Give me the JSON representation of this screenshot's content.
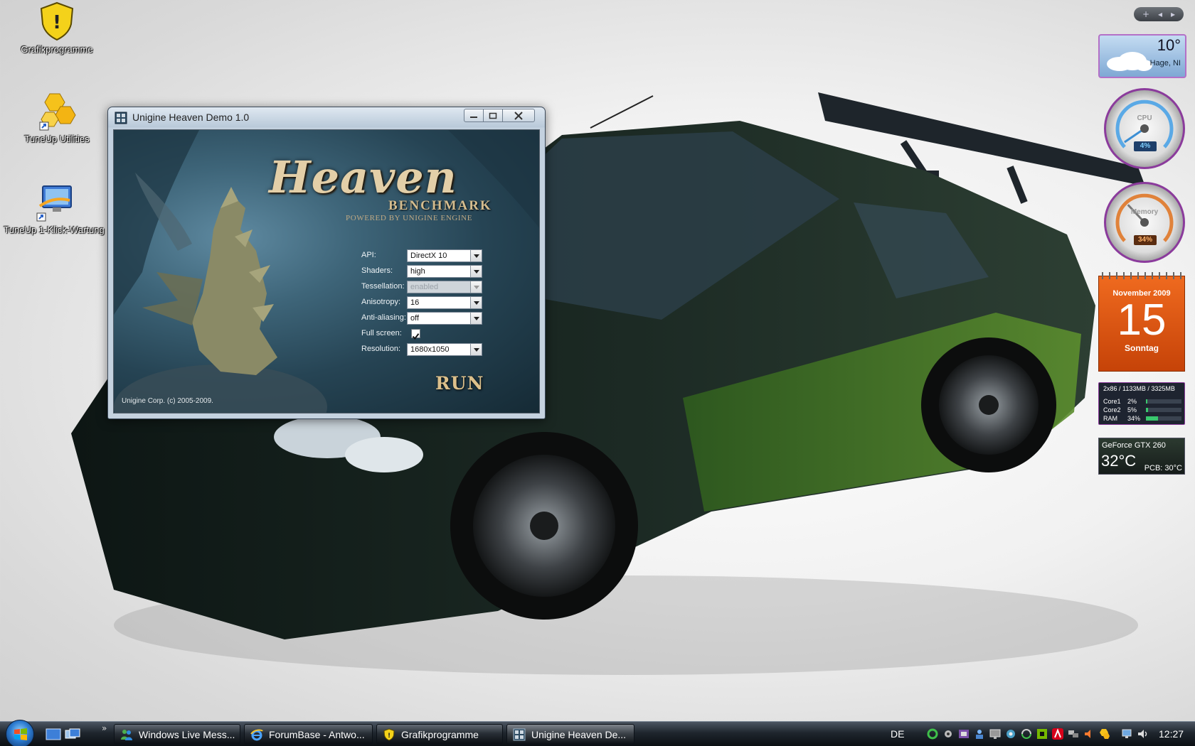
{
  "desktop": {
    "icons": [
      {
        "label": "Grafikprogramme",
        "icon": "shield-warning-icon"
      },
      {
        "label": "TuneUp Utilities",
        "icon": "tuneup-icon"
      },
      {
        "label": "TuneUp 1-Klick-Wartung",
        "icon": "monitor-shortcut-icon"
      }
    ]
  },
  "window": {
    "title": "Unigine Heaven Demo 1.0",
    "brand": {
      "title": "Heaven",
      "subtitle": "BENCHMARK",
      "powered": "POWERED BY UNIGINE ENGINE"
    },
    "options": {
      "api": {
        "label": "API:",
        "value": "DirectX 10"
      },
      "shaders": {
        "label": "Shaders:",
        "value": "high"
      },
      "tessellation": {
        "label": "Tessellation:",
        "value": "enabled",
        "disabled": true
      },
      "anisotropy": {
        "label": "Anisotropy:",
        "value": "16"
      },
      "antialiasing": {
        "label": "Anti-aliasing:",
        "value": "off"
      },
      "fullscreen": {
        "label": "Full screen:",
        "checked": true
      },
      "resolution": {
        "label": "Resolution:",
        "value": "1680x1050"
      }
    },
    "run_label": "RUN",
    "copyright": "Unigine Corp. (c) 2005-2009."
  },
  "sidebar": {
    "controls": [
      "+",
      "◂",
      "▸"
    ],
    "weather": {
      "temp": "10°",
      "location": "Hage, NI"
    },
    "cpu_gauge": {
      "label": "CPU",
      "value": "4%",
      "fraction": 0.04
    },
    "memory_gauge": {
      "label": "Memory",
      "value": "34%",
      "fraction": 0.34
    },
    "calendar": {
      "month": "November 2009",
      "day": "15",
      "weekday": "Sonntag"
    },
    "sysmon": {
      "header": "2x86 / 1133MB / 3325MB",
      "rows": [
        {
          "name": "Core1",
          "value": "2%",
          "fraction": 0.02
        },
        {
          "name": "Core2",
          "value": "5%",
          "fraction": 0.05
        },
        {
          "name": "RAM",
          "value": "34%",
          "fraction": 0.34
        }
      ]
    },
    "gpu": {
      "name": "GeForce GTX 260",
      "temp": "32°C",
      "pcb": "PCB: 30°C"
    }
  },
  "taskbar": {
    "quicklaunch_more": "»",
    "buttons": [
      {
        "label": "Windows Live Mess...",
        "icon": "messenger-icon",
        "active": false
      },
      {
        "label": "ForumBase - Antwo...",
        "icon": "ie-icon",
        "active": false
      },
      {
        "label": "Grafikprogramme",
        "icon": "shield-warning-icon",
        "active": false
      },
      {
        "label": "Unigine Heaven De...",
        "icon": "heaven-app-icon",
        "active": true
      }
    ],
    "language": "DE",
    "clock": "12:27"
  },
  "colors": {
    "accent": "#b470c7",
    "calendar": "#e35b14",
    "heaven_gold": "#dcc08b"
  }
}
